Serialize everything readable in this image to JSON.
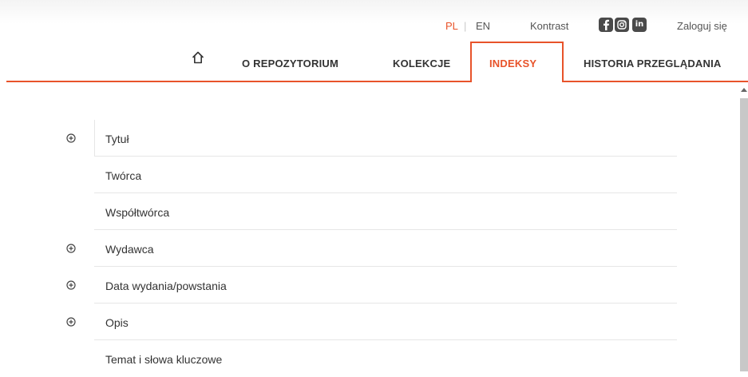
{
  "header": {
    "lang_pl": "PL",
    "lang_separator": "|",
    "lang_en": "EN",
    "contrast_label": "Kontrast",
    "social_icons": [
      "facebook-icon",
      "instagram-icon",
      "linkedin-icon"
    ],
    "linkedin_glyph": "in",
    "login_label": "Zaloguj się"
  },
  "nav": {
    "home_icon": "home-icon",
    "items": [
      {
        "label": "O REPOZYTORIUM",
        "active": false
      },
      {
        "label": "KOLEKCJE",
        "active": false
      },
      {
        "label": "INDEKSY",
        "active": true
      },
      {
        "label": "HISTORIA PRZEGLĄDANIA",
        "active": false
      }
    ]
  },
  "indexes": [
    {
      "label": "Tytuł",
      "expandable": true
    },
    {
      "label": "Twórca",
      "expandable": false
    },
    {
      "label": "Współtwórca",
      "expandable": false
    },
    {
      "label": "Wydawca",
      "expandable": true
    },
    {
      "label": "Data wydania/powstania",
      "expandable": true
    },
    {
      "label": "Opis",
      "expandable": true
    },
    {
      "label": "Temat i słowa kluczowe",
      "expandable": false
    }
  ],
  "colors": {
    "accent": "#e8532a",
    "text": "#333333",
    "muted_text": "#555555",
    "divider": "#e6e6e6",
    "social_bg": "#4a4a4a",
    "scrollbar": "#c8c8c8"
  }
}
